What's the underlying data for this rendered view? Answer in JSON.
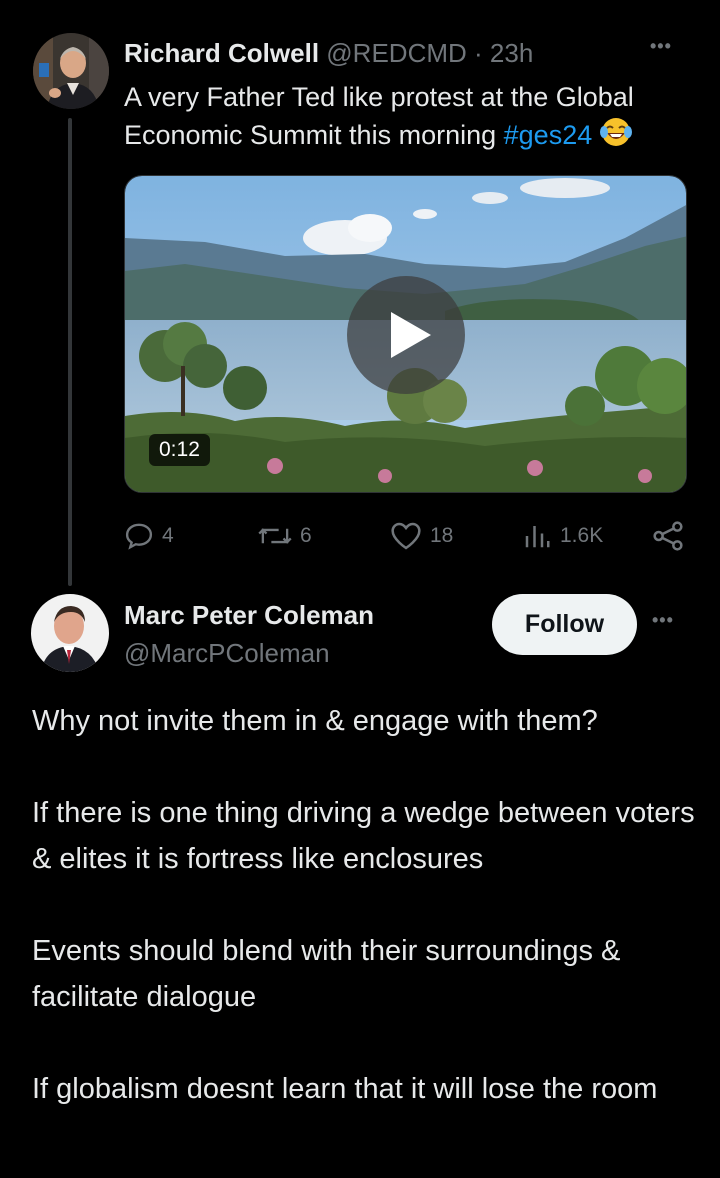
{
  "tweet": {
    "author_name": "Richard Colwell",
    "author_handle": "@REDCMD",
    "separator": "·",
    "time": "23h",
    "text_main": "A very Father Ted like protest at the Global Economic Summit this morning",
    "hashtag": "#ges24",
    "emoji_icon": "face-with-tears-of-joy-icon",
    "video_duration": "0:12",
    "stats": {
      "replies": "4",
      "reposts": "6",
      "likes": "18",
      "views": "1.6K"
    }
  },
  "reply": {
    "author_name": "Marc Peter Coleman",
    "author_handle": "@MarcPColeman",
    "follow_label": "Follow",
    "paragraphs": [
      "Why not invite them in & engage with them?",
      "If there is one thing driving a wedge between voters & elites it is fortress like enclosures",
      "Events should blend with their surroundings & facilitate dialogue",
      "If globalism doesnt learn that it will lose the room"
    ]
  },
  "more_label": "•••",
  "colors": {
    "background": "#000000",
    "text": "#e7e9ea",
    "muted": "#71767b",
    "link": "#1d9bf0",
    "follow_bg": "#eff3f4"
  }
}
